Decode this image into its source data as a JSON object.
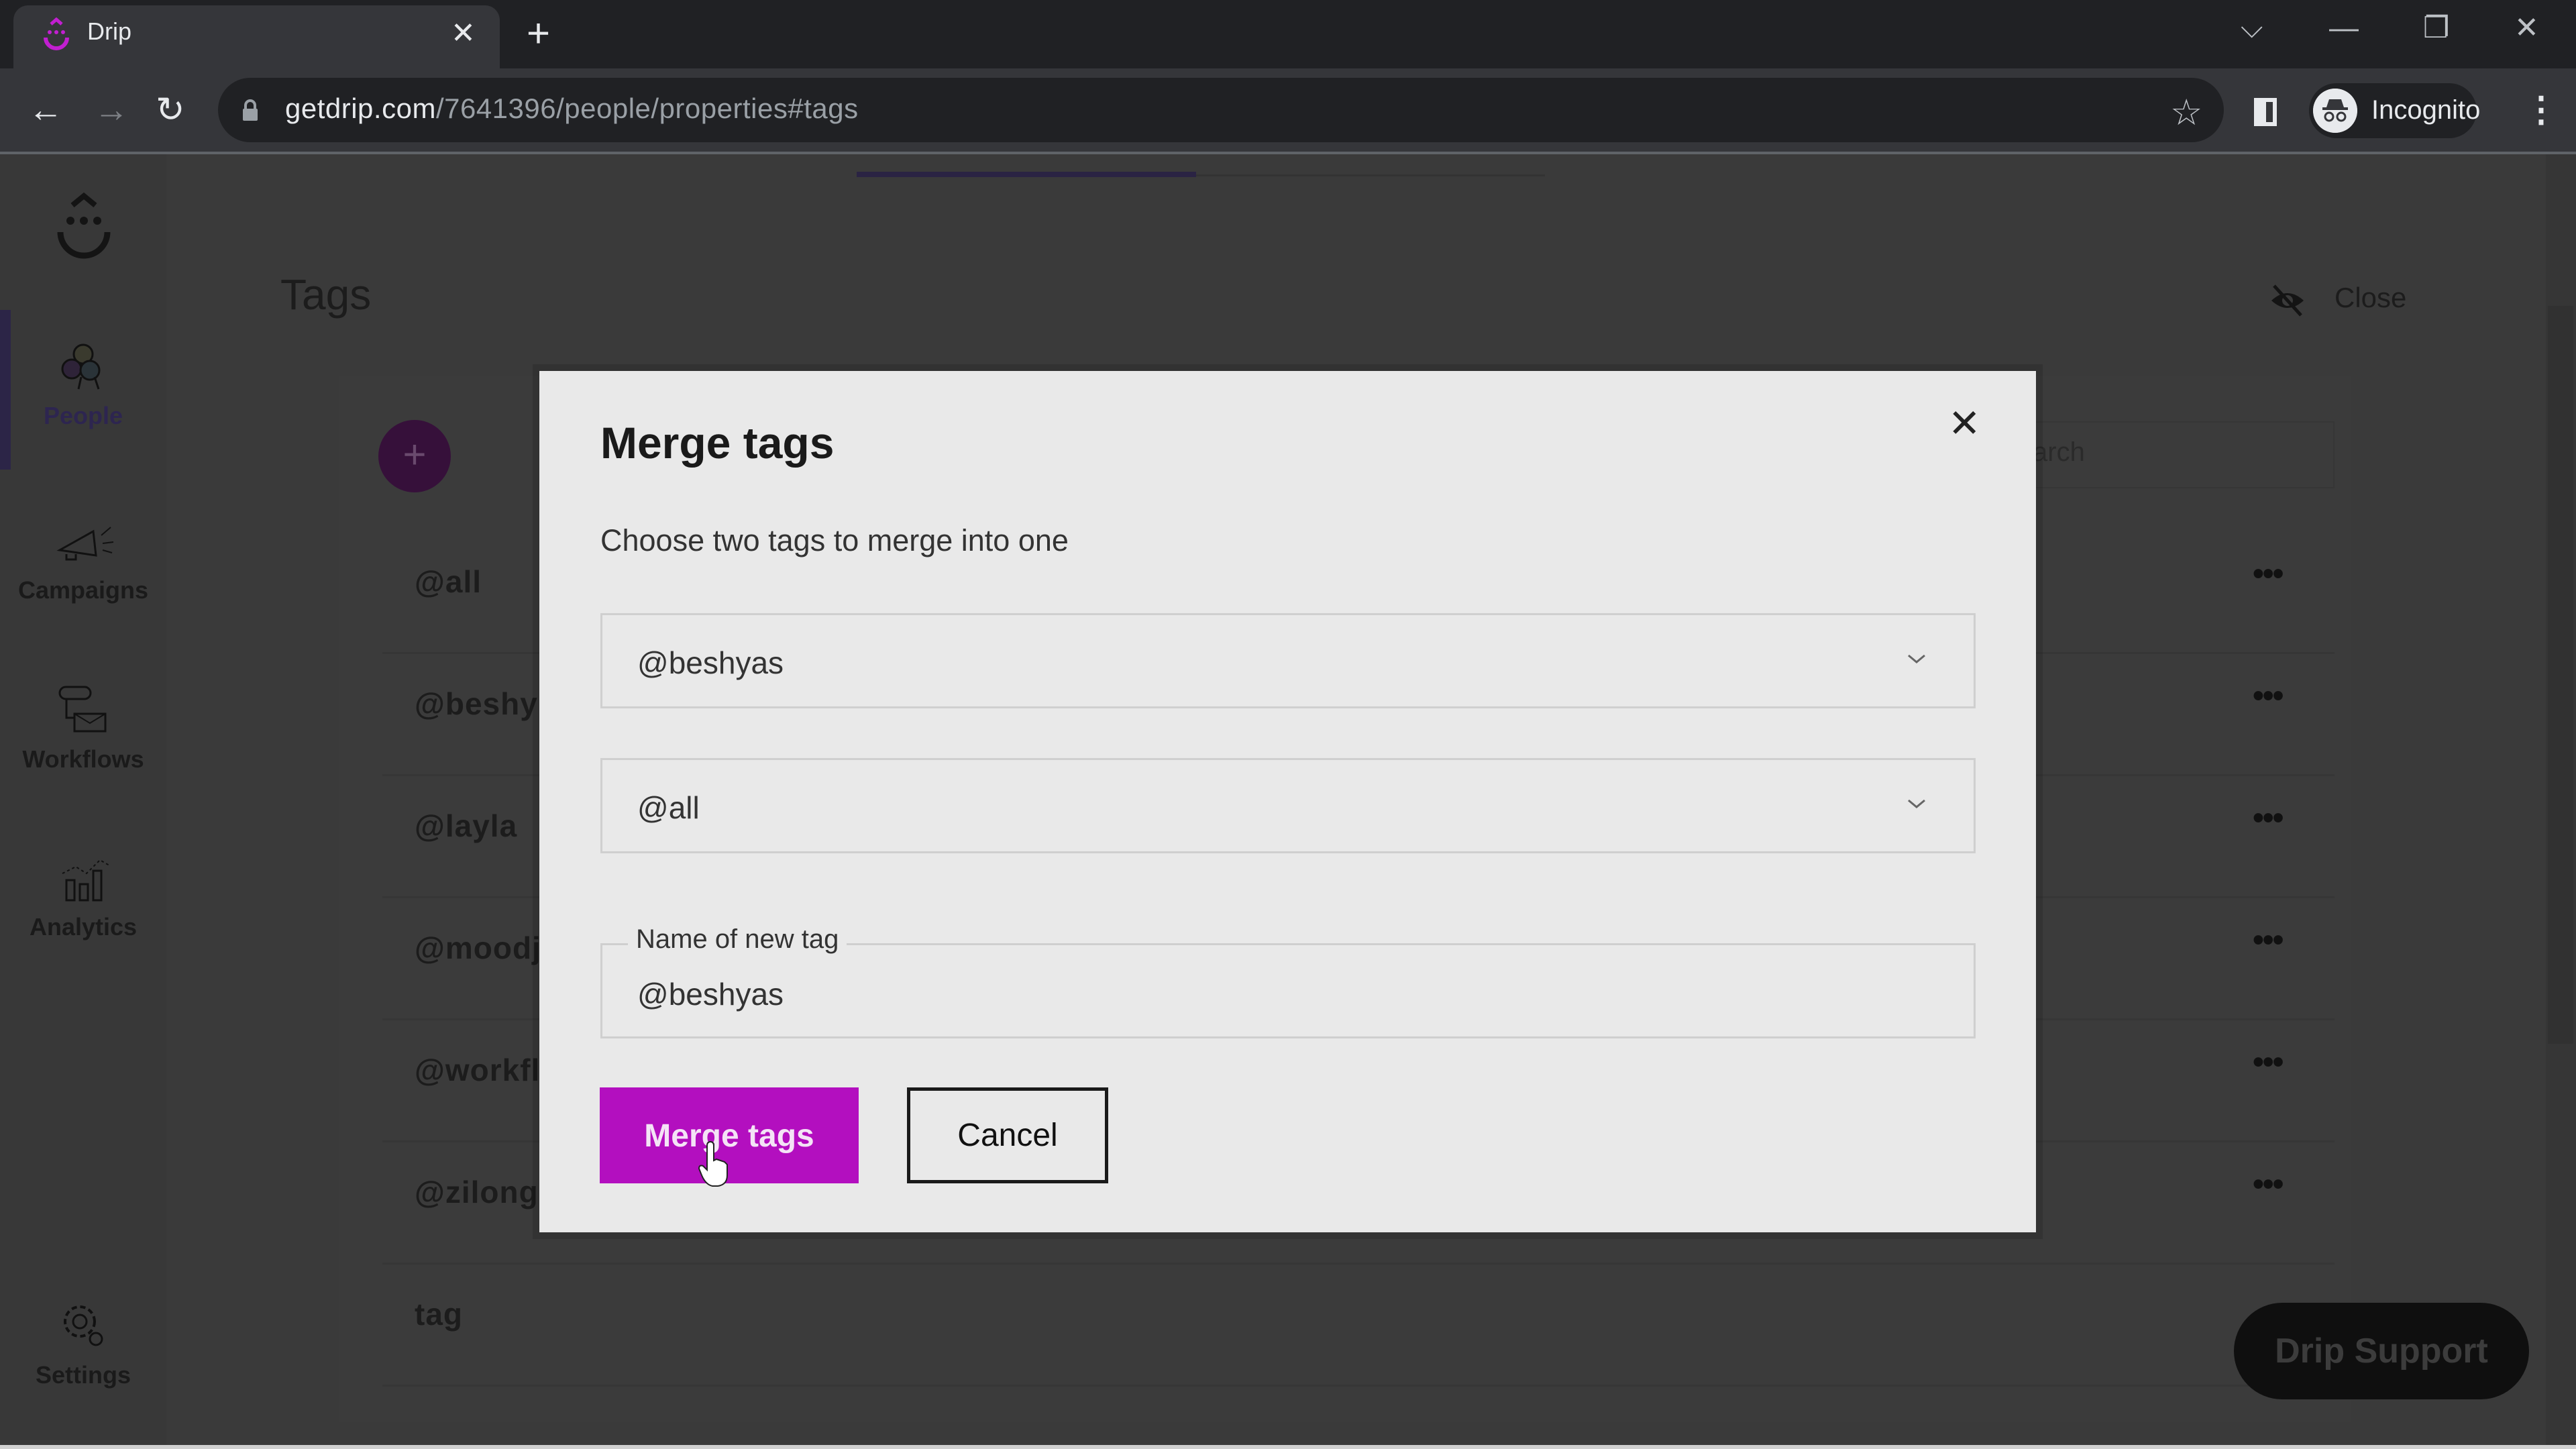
{
  "browser": {
    "tab_title": "Drip",
    "url_host": "getdrip.com",
    "url_path": "/7641396/people/properties#tags",
    "profile_label": "Incognito",
    "icons": {
      "favicon": "drip-logo-icon",
      "tab_close": "close-icon",
      "new_tab": "plus-icon",
      "back": "arrow-left-icon",
      "forward": "arrow-right-icon",
      "reload": "reload-icon",
      "lock": "lock-icon",
      "bookmark": "star-icon",
      "side_panel": "side-panel-icon",
      "incognito": "incognito-icon",
      "menu": "kebab-menu-icon",
      "tab_search": "chevron-down-icon",
      "minimize": "minimize-icon",
      "restore": "restore-icon",
      "close_window": "close-icon"
    },
    "glyphs": {
      "tab_close": "✕",
      "new_tab": "+",
      "back": "←",
      "forward": "→",
      "reload": "↻",
      "star": "☆",
      "kebab": "⋮",
      "tab_search": "⌵",
      "minimize": "—",
      "restore": "❐",
      "close": "✕"
    }
  },
  "sidebar": {
    "items": [
      {
        "label": "People",
        "icon": "people-icon",
        "active": true
      },
      {
        "label": "Campaigns",
        "icon": "megaphone-icon",
        "active": false
      },
      {
        "label": "Workflows",
        "icon": "workflow-icon",
        "active": false
      },
      {
        "label": "Analytics",
        "icon": "bar-chart-icon",
        "active": false
      },
      {
        "label": "Settings",
        "icon": "gear-icon",
        "active": false
      }
    ]
  },
  "page": {
    "title": "Tags",
    "close_label": "Close",
    "add_glyph": "+",
    "search_placeholder": "Search",
    "search_visible_fragment": "arch",
    "tags": [
      "@all",
      "@beshyas",
      "@layla",
      "@moodj",
      "@workfl",
      "@zilong",
      "tag"
    ],
    "tags_visible": [
      "@all",
      "@beshy",
      "@layla",
      "@moodj",
      "@workfl",
      "@zilong",
      "tag"
    ],
    "row_menu_glyph": "•••",
    "support_label": "Drip Support"
  },
  "modal": {
    "title": "Merge tags",
    "close_glyph": "✕",
    "subtitle": "Choose two tags to merge into one",
    "first_tag": "@beshyas",
    "second_tag": "@all",
    "new_tag_label": "Name of new tag",
    "new_tag_value": "@beshyas",
    "merge_label": "Merge tags",
    "cancel_label": "Cancel"
  },
  "colors": {
    "accent": "#b30fbf",
    "overlay_bg": "#3a3a3a",
    "modal_bg": "#e9e9e9"
  }
}
